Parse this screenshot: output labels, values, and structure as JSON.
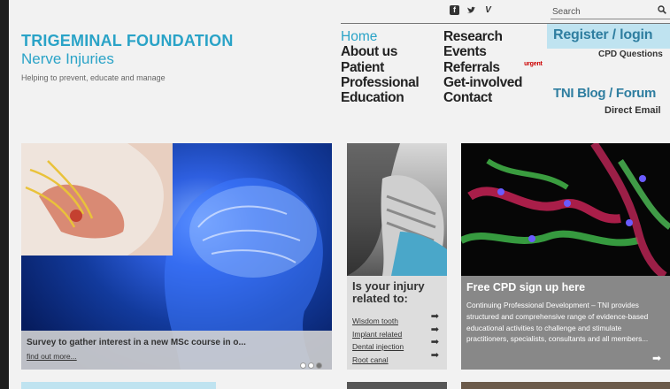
{
  "brand": {
    "title": "TRIGEMINAL FOUNDATION",
    "subtitle": "Nerve Injuries",
    "tagline": "Helping to prevent, educate and manage",
    "accent_color": "#2aa3c7"
  },
  "social": [
    {
      "icon": "facebook-icon",
      "glyph": "f"
    },
    {
      "icon": "twitter-icon",
      "glyph": "❧"
    },
    {
      "icon": "vimeo-icon",
      "glyph": "V"
    }
  ],
  "search": {
    "placeholder": "Search",
    "icon": "search-icon"
  },
  "nav": {
    "col1": [
      "Home",
      "About us",
      "Patient",
      "Professional",
      "Education"
    ],
    "col2": [
      "Research",
      "Events",
      "Referrals",
      "Get-involved",
      "Contact"
    ],
    "urgent_badge": "urgent"
  },
  "register": {
    "label": "Register / login",
    "cpd_questions": "CPD Questions"
  },
  "blog": {
    "label": "TNI Blog / Forum",
    "direct_email": "Direct Email"
  },
  "carousel": {
    "caption": "Survey to gather interest in a new MSc course in o...",
    "link": "find out more...",
    "slide_count": 3,
    "active_slide": 3
  },
  "injury_card": {
    "title_line1": "Is your injury",
    "title_line2": "related to:",
    "links": [
      "Wisdom tooth",
      "Implant related",
      "Dental injection",
      "Root canal"
    ]
  },
  "cpd_card": {
    "title": "Free CPD sign up here",
    "body": "Continuing Professional Development – TNI provides structured and comprehensive range of evidence-based educational activities to challenge and stimulate practitioners, specialists, consultants and all members..."
  }
}
